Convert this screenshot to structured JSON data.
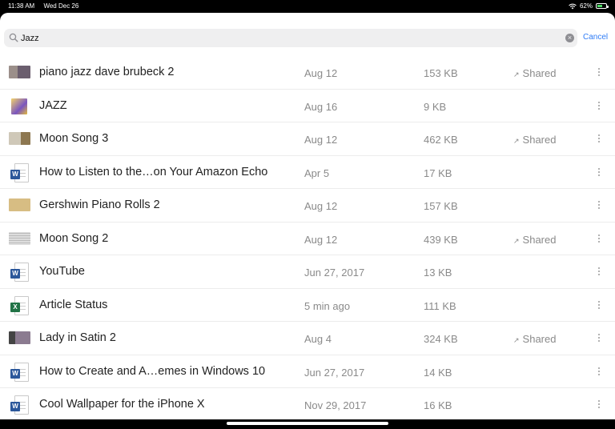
{
  "status_bar": {
    "time": "11:38 AM",
    "date": "Wed Dec 26",
    "battery": "62%",
    "battery_level": 0.62
  },
  "search": {
    "value": "Jazz",
    "cancel_label": "Cancel",
    "icon": "search-icon",
    "clear_icon": "clear-icon",
    "clear_glyph": "×"
  },
  "files": [
    {
      "name": "piano jazz dave brubeck 2",
      "date": "Aug 12",
      "size": "153 KB",
      "shared": "Shared",
      "thumb": "pic"
    },
    {
      "name": "JAZZ",
      "date": "Aug 16",
      "size": "9 KB",
      "shared": "",
      "thumb": "art"
    },
    {
      "name": "Moon Song 3",
      "date": "Aug 12",
      "size": "462 KB",
      "shared": "Shared",
      "thumb": "moon"
    },
    {
      "name": "How to Listen to the…on Your Amazon Echo",
      "date": "Apr 5",
      "size": "17 KB",
      "shared": "",
      "thumb": "word"
    },
    {
      "name": "Gershwin Piano Rolls 2",
      "date": "Aug 12",
      "size": "157 KB",
      "shared": "",
      "thumb": "paper"
    },
    {
      "name": "Moon Song 2",
      "date": "Aug 12",
      "size": "439 KB",
      "shared": "Shared",
      "thumb": "sheetmusic"
    },
    {
      "name": "YouTube",
      "date": "Jun 27, 2017",
      "size": "13 KB",
      "shared": "",
      "thumb": "word"
    },
    {
      "name": "Article Status",
      "date": "5 min ago",
      "size": "111 KB",
      "shared": "",
      "thumb": "excel"
    },
    {
      "name": "Lady in Satin 2",
      "date": "Aug 4",
      "size": "324 KB",
      "shared": "Shared",
      "thumb": "film"
    },
    {
      "name": "How to Create and A…emes in Windows 10",
      "date": "Jun 27, 2017",
      "size": "14 KB",
      "shared": "",
      "thumb": "word"
    },
    {
      "name": "Cool Wallpaper for the iPhone X",
      "date": "Nov 29, 2017",
      "size": "16 KB",
      "shared": "",
      "thumb": "word"
    }
  ],
  "icons": {
    "shared": "link-icon",
    "more": "more-icon",
    "word_badge": "W",
    "excel_badge": "X"
  },
  "colors": {
    "accent": "#2f7cf6",
    "word": "#2b579a",
    "excel": "#217346"
  }
}
